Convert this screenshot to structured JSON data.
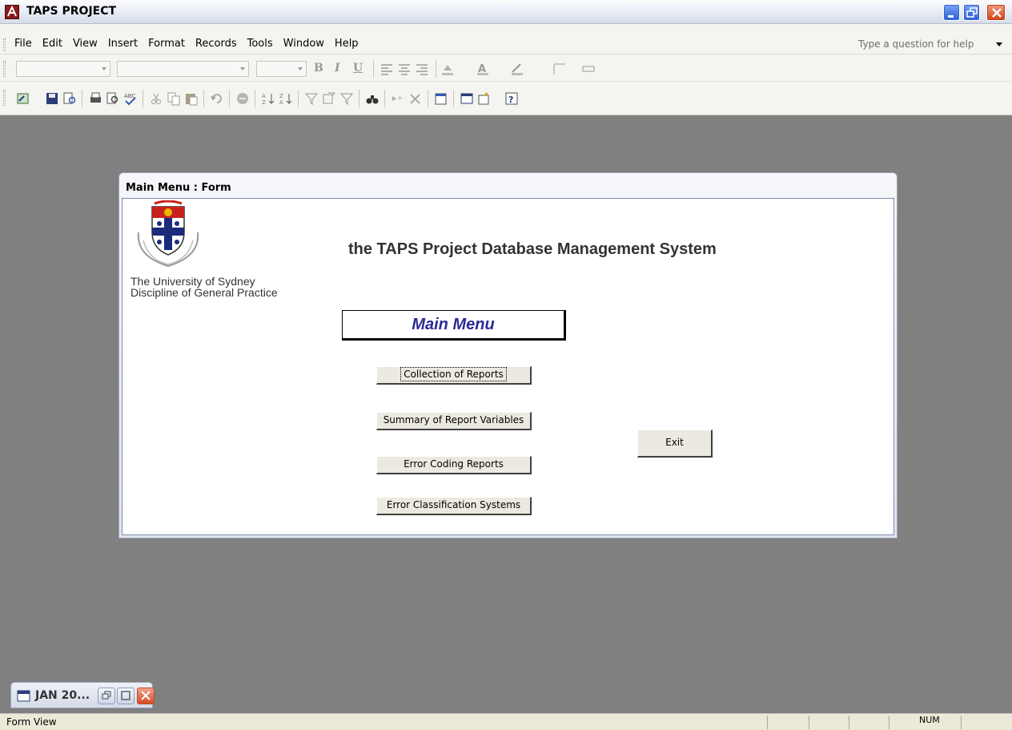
{
  "window": {
    "title": "TAPS PROJECT",
    "controls": [
      "minimize",
      "restore",
      "close"
    ]
  },
  "menubar": {
    "items": [
      "File",
      "Edit",
      "View",
      "Insert",
      "Format",
      "Records",
      "Tools",
      "Window",
      "Help"
    ],
    "help_placeholder": "Type a question for help"
  },
  "form": {
    "title": "Main Menu : Form",
    "university_line1": "The University of Sydney",
    "university_line2": "Discipline of General Practice",
    "heading": "the TAPS Project Database Management System",
    "menu_label": "Main Menu",
    "buttons": {
      "collection": "Collection of  Reports",
      "summary": "Summary of Report Variables",
      "error_coding": "Error Coding Reports",
      "error_class": "Error Classification Systems",
      "exit": "Exit"
    }
  },
  "minimized_window": {
    "title": "JAN 20..."
  },
  "statusbar": {
    "mode": "Form View",
    "num": "NUM"
  }
}
